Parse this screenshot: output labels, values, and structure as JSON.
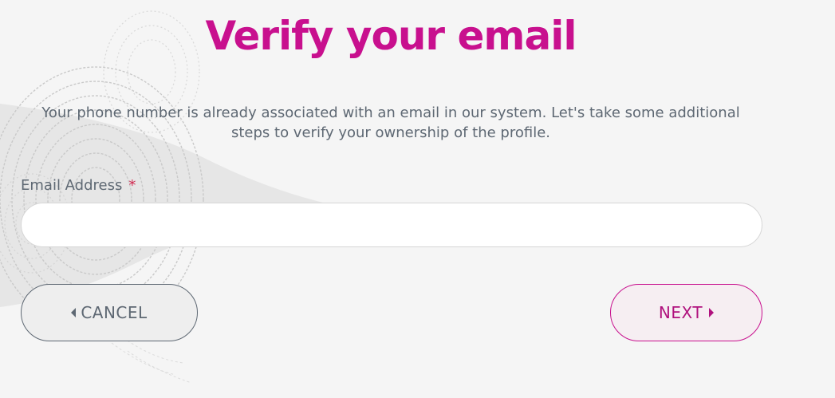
{
  "heading": "Verify your email",
  "description": "Your phone number is already associated with an email in our system. Let's take some additional steps to verify your ownership of the profile.",
  "form": {
    "email_label": "Email Address",
    "required_marker": "*",
    "email_value": "",
    "email_placeholder": ""
  },
  "buttons": {
    "cancel_label": "CANCEL",
    "next_label": "NEXT"
  },
  "icons": {
    "cancel": "caret-left-icon",
    "next": "caret-right-icon",
    "background": "fingerprint-pattern"
  },
  "colors": {
    "accent": "#c8108e",
    "text": "#5e6873",
    "required": "#d0284f",
    "background": "#f5f5f5"
  }
}
